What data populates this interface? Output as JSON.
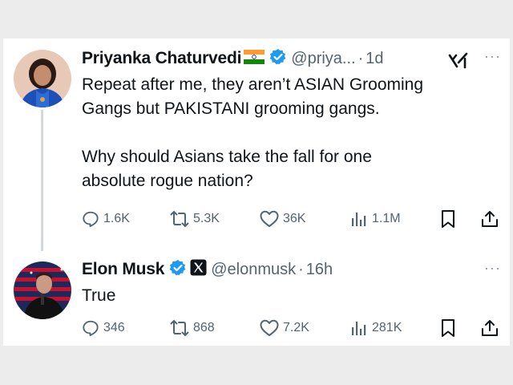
{
  "tweets": [
    {
      "author_name": "Priyanka Chaturvedi",
      "handle": "@priya...",
      "separator": "·",
      "time": "1d",
      "text_lines": [
        "Repeat after me, they aren’t ASIAN Grooming",
        "Gangs but PAKISTANI grooming gangs."
      ],
      "text_lines_2": [
        "Why should Asians take the fall for one",
        "absolute rogue nation?"
      ],
      "stats": {
        "replies": "1.6K",
        "reposts": "5.3K",
        "likes": "36K",
        "views": "1.1M"
      },
      "icons": [
        "india-flag-icon",
        "verified-badge-icon",
        "grok-icon",
        "more-icon"
      ]
    },
    {
      "author_name": "Elon Musk",
      "handle": "@elonmusk",
      "separator": "·",
      "time": "16h",
      "text": "True",
      "stats": {
        "replies": "346",
        "reposts": "868",
        "likes": "7.2K",
        "views": "281K"
      },
      "icons": [
        "verified-badge-icon",
        "x-affiliate-badge-icon",
        "more-icon"
      ]
    }
  ],
  "more_symbol": "···",
  "colors": {
    "text": "#0f1419",
    "secondary": "#536471",
    "verified": "#1d9bf0",
    "thread_line": "#cfd9de",
    "background": "#ececec"
  }
}
